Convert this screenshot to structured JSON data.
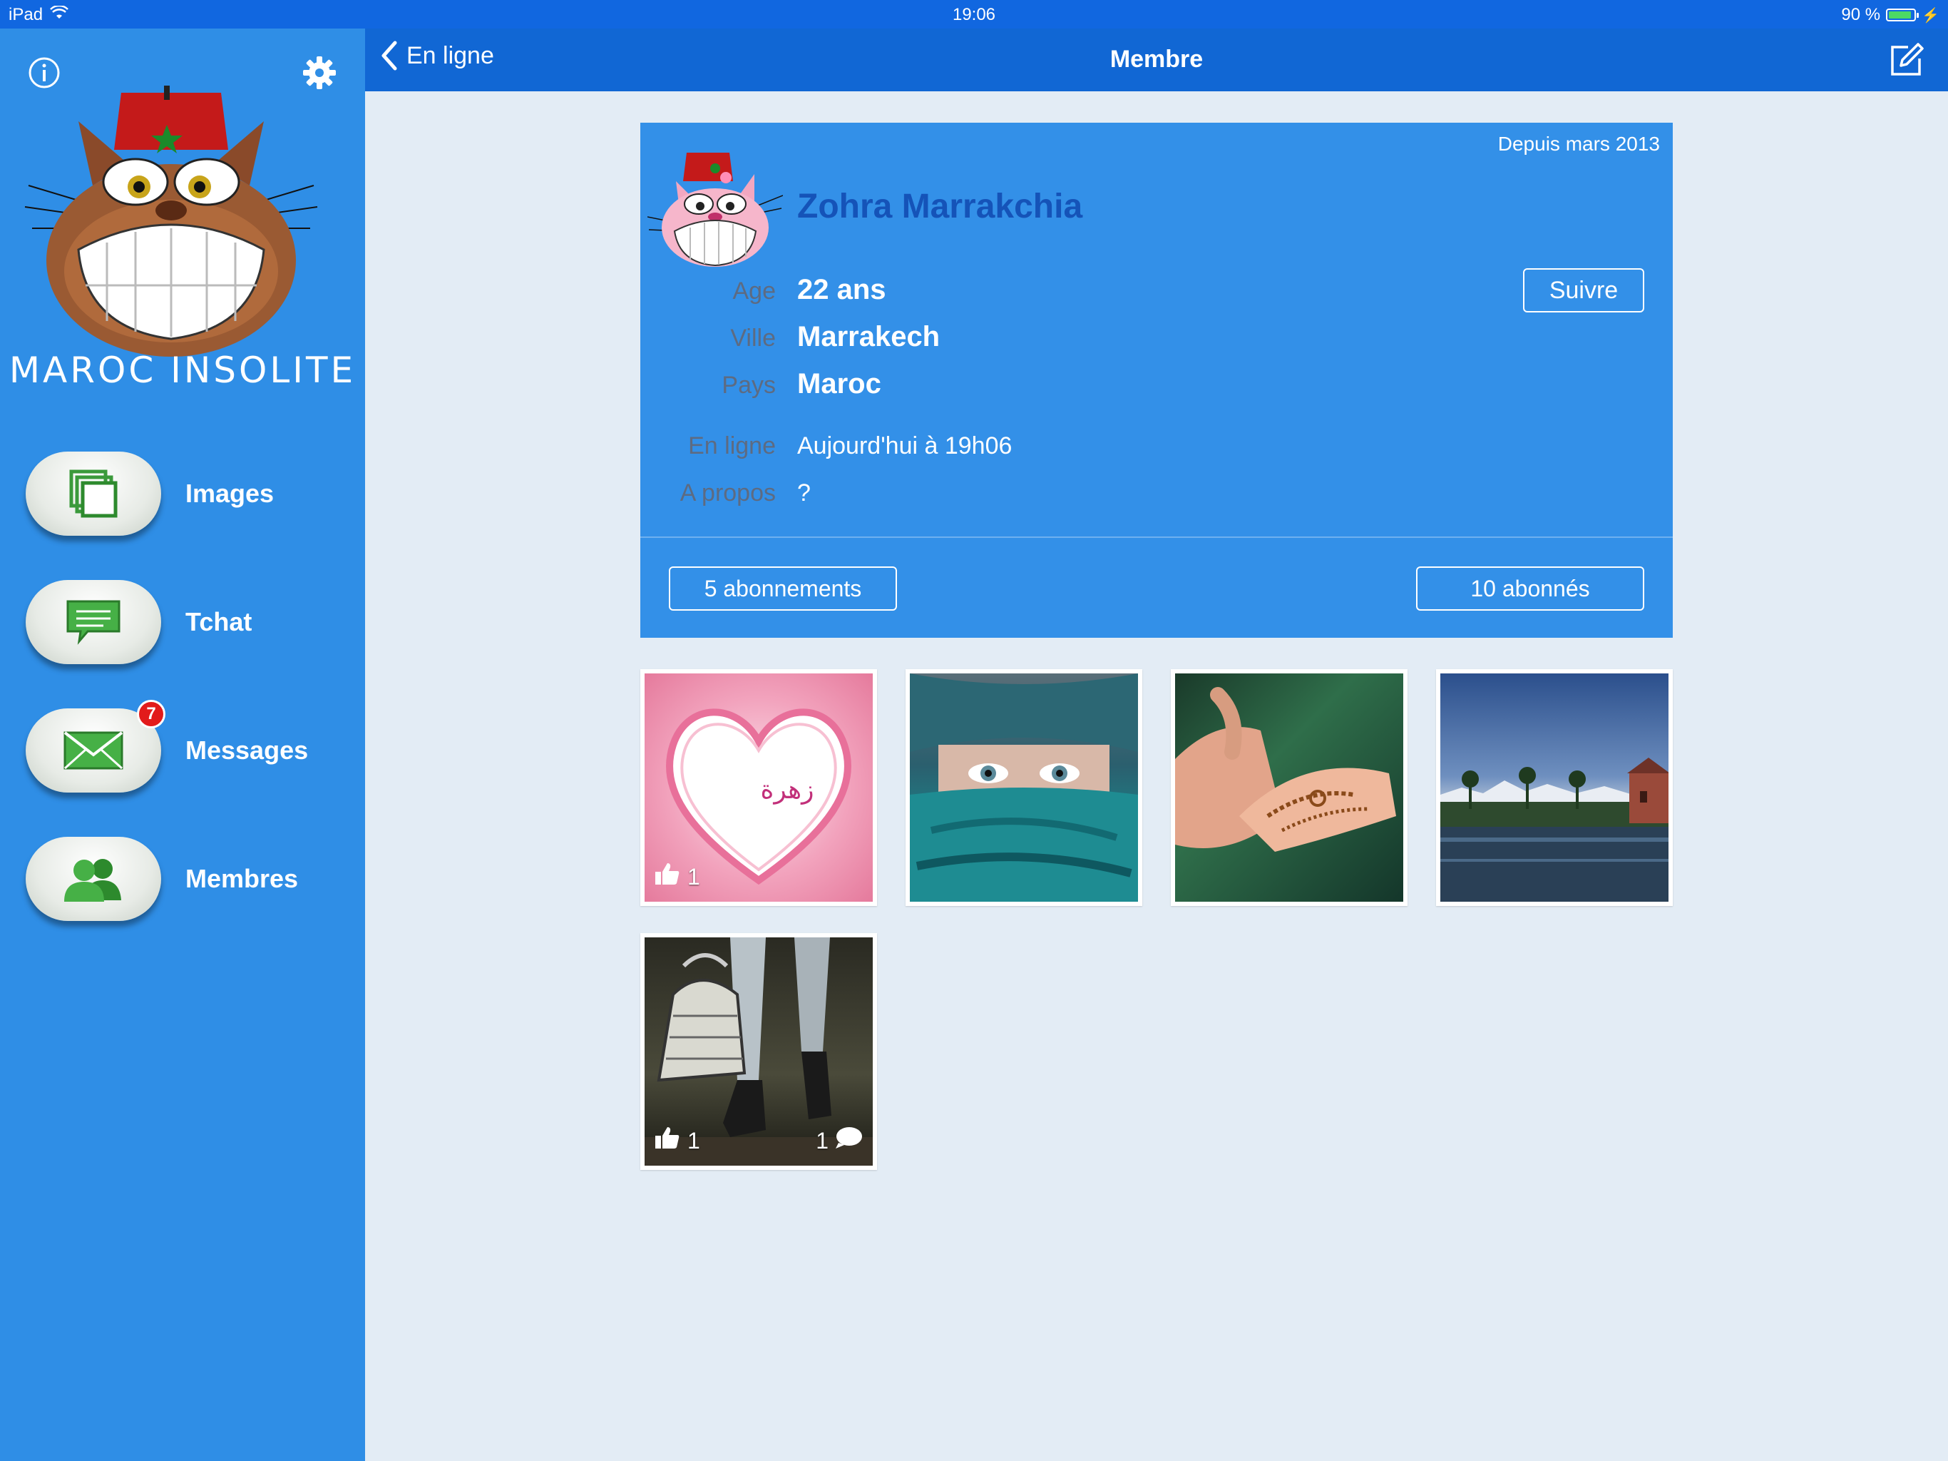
{
  "status_bar": {
    "device": "iPad",
    "time": "19:06",
    "battery": "90 %",
    "battery_level": 0.9
  },
  "sidebar": {
    "app_title": "MAROC INSOLITE",
    "items": [
      {
        "label": "Images",
        "icon": "images-icon"
      },
      {
        "label": "Tchat",
        "icon": "chat-bubble-icon"
      },
      {
        "label": "Messages",
        "icon": "envelope-icon",
        "badge": "7"
      },
      {
        "label": "Membres",
        "icon": "members-icon"
      }
    ]
  },
  "navbar": {
    "back_label": "En ligne",
    "title": "Membre"
  },
  "profile": {
    "since": "Depuis mars 2013",
    "name": "Zohra Marrakchia",
    "follow_label": "Suivre",
    "fields": [
      {
        "label": "Age",
        "value": "22 ans"
      },
      {
        "label": "Ville",
        "value": "Marrakech"
      },
      {
        "label": "Pays",
        "value": "Maroc"
      },
      {
        "label": "En ligne",
        "value": "Aujourd'hui à 19h06"
      },
      {
        "label": "A propos",
        "value": "?"
      }
    ],
    "subscriptions_label": "5 abonnements",
    "followers_label": "10 abonnés"
  },
  "photos": [
    {
      "likes": "1",
      "caption": "زهرة"
    },
    {},
    {},
    {},
    {
      "likes": "1",
      "comments": "1"
    }
  ],
  "colors": {
    "sidebar": "#2f8ee6",
    "navbar": "#1167d4",
    "card": "#3390e8",
    "name": "#1553b8",
    "background": "#e3ecf5"
  }
}
